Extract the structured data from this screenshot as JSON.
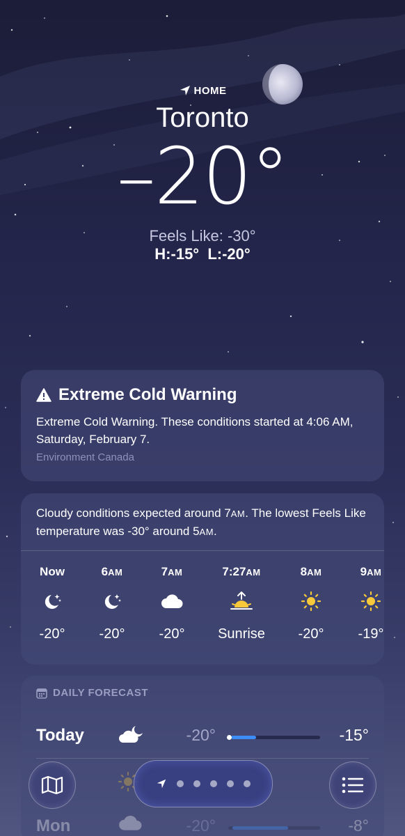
{
  "location": {
    "tag": "HOME",
    "city": "Toronto",
    "temperature": "–20°",
    "feels_like": "Feels Like: -30°",
    "high_low": "H:-15°  L:-20°"
  },
  "alert": {
    "title": "Extreme Cold Warning",
    "body": "Extreme Cold Warning. These conditions started at 4:06 AM, Saturday, February 7.",
    "source": "Environment Canada"
  },
  "hourly": {
    "summary_part1": "Cloudy conditions expected around 7",
    "summary_am1": "AM",
    "summary_part2": ". The lowest Feels Like temperature was -30° around 5",
    "summary_am2": "AM",
    "summary_part3": ".",
    "items": [
      {
        "time": "Now",
        "suffix": "",
        "icon": "moon-stars-icon",
        "value": "-20°"
      },
      {
        "time": "6",
        "suffix": "AM",
        "icon": "moon-stars-icon",
        "value": "-20°"
      },
      {
        "time": "7",
        "suffix": "AM",
        "icon": "cloud-icon",
        "value": "-20°"
      },
      {
        "time": "7:27",
        "suffix": "AM",
        "icon": "sunrise-icon",
        "value": "Sunrise"
      },
      {
        "time": "8",
        "suffix": "AM",
        "icon": "sun-icon",
        "value": "-20°"
      },
      {
        "time": "9",
        "suffix": "AM",
        "icon": "sun-icon",
        "value": "-19°"
      }
    ]
  },
  "daily": {
    "header": "DAILY FORECAST",
    "days": [
      {
        "name": "Today",
        "icon": "cloud-moon-icon",
        "low": "-20°",
        "high": "-15°",
        "range_start": 0.0,
        "range_end": 0.27,
        "current": 0.0
      },
      {
        "name": "",
        "icon": "sun-icon",
        "low": "",
        "high": "",
        "range_start": 0.0,
        "range_end": 0.3
      },
      {
        "name": "Mon",
        "icon": "cloud-icon",
        "low": "-20°",
        "high": "-8°",
        "range_start": 0.05,
        "range_end": 0.6
      }
    ]
  },
  "nav": {
    "map_icon": "map-icon",
    "location_arrow_icon": "location-arrow-icon",
    "list_icon": "list-icon",
    "page_dots": 5
  },
  "colors": {
    "background_top": "#1c1d38",
    "background_bottom": "#50567f",
    "card": "#464a78",
    "accent_blue": "#3e8cf5",
    "sun_yellow": "#f7c83a"
  }
}
